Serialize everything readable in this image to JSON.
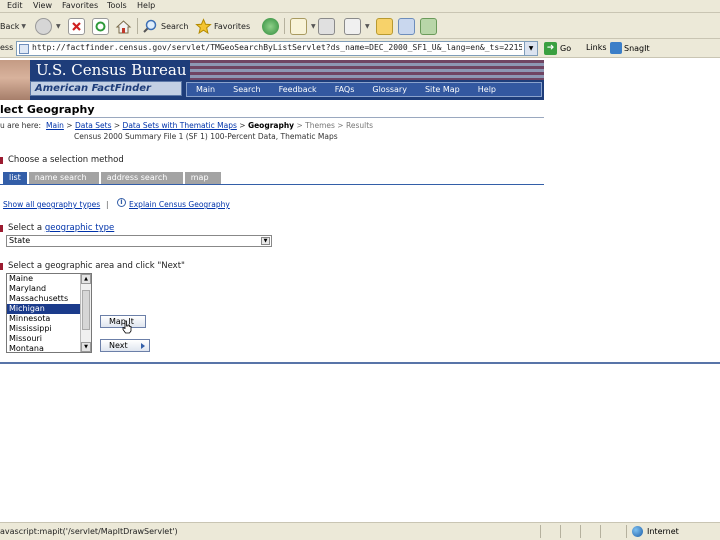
{
  "browser": {
    "menu": [
      "Edit",
      "View",
      "Favorites",
      "Tools",
      "Help"
    ],
    "toolbar": {
      "back_label": "Back",
      "search_label": "Search",
      "favorites_label": "Favorites"
    },
    "address": {
      "label": "ess",
      "url": "http://factfinder.census.gov/servlet/TMGeoSearchByListServlet?ds_name=DEC_2000_SF1_U&_lang=en&_ts=221560330191",
      "go_label": "Go",
      "links_label": "Links",
      "snagit_label": "SnagIt"
    },
    "status": {
      "text": "avascript:mapit('/servlet/MapItDrawServlet')",
      "zone": "Internet"
    }
  },
  "site": {
    "title": "U.S. Census Bureau",
    "subtitle": "American FactFinder",
    "nav": [
      "Main",
      "Search",
      "Feedback",
      "FAQs",
      "Glossary",
      "Site Map",
      "Help"
    ]
  },
  "page": {
    "title": "lect Geography",
    "breadcrumb_label": "u are here:",
    "breadcrumb": {
      "main": "Main",
      "data_sets": "Data Sets",
      "thematic_maps": "Data Sets with Thematic Maps",
      "current": "Geography",
      "themes": "Themes",
      "results": "Results"
    },
    "dataset_desc": "Census 2000 Summary File 1 (SF 1) 100-Percent Data, Thematic Maps",
    "method_heading": "Choose a selection method",
    "tabs": [
      "list",
      "name search",
      "address search",
      "map"
    ],
    "show_all_link": "Show all geography types",
    "separator": "|",
    "explain_link": "Explain Census Geography",
    "geo_type": {
      "prefix": "Select a ",
      "link": "geographic type",
      "value": "State"
    },
    "geo_area": {
      "heading": "Select a geographic area and click \"Next\"",
      "items": [
        "Maine",
        "Maryland",
        "Massachusetts",
        "Michigan",
        "Minnesota",
        "Mississippi",
        "Missouri",
        "Montana"
      ],
      "selected": "Michigan"
    },
    "map_it_button": "Map It",
    "next_button": "Next"
  }
}
